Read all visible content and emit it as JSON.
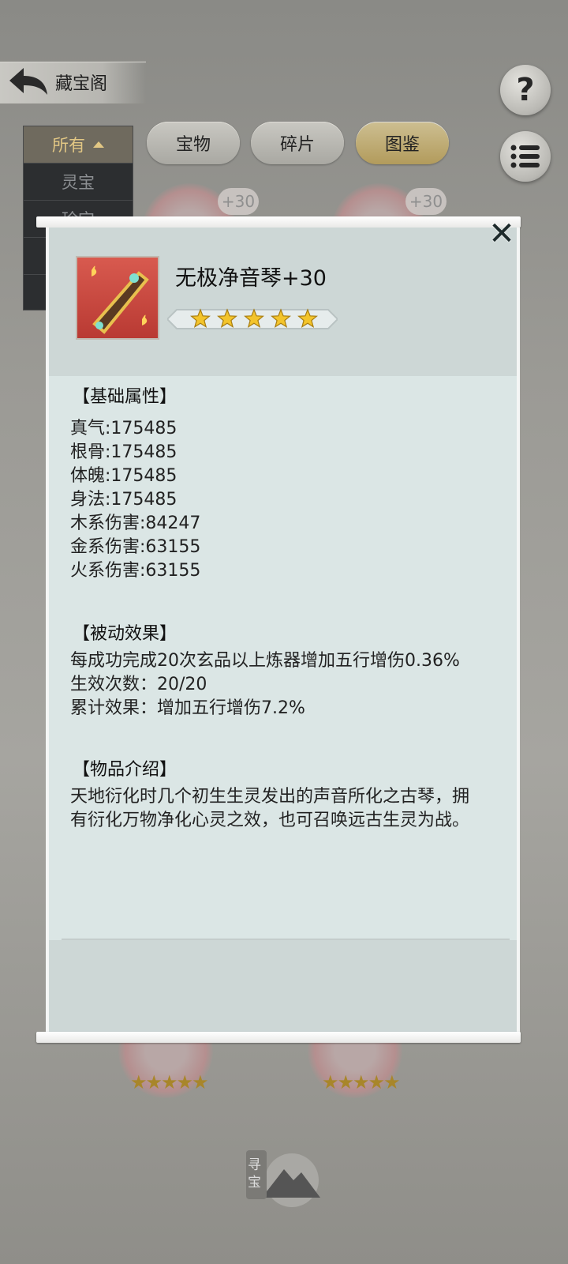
{
  "header": {
    "title": "藏宝阁",
    "help_symbol": "?"
  },
  "filter": {
    "selected": "所有",
    "options": [
      "灵宝",
      "珍宝",
      "",
      ""
    ]
  },
  "tabs": [
    {
      "label": "宝物",
      "active": false
    },
    {
      "label": "碎片",
      "active": false
    },
    {
      "label": "图鉴",
      "active": true
    }
  ],
  "background_items": [
    {
      "badge": "+30"
    },
    {
      "badge": "+30"
    }
  ],
  "bottom_button": {
    "label": "寻宝"
  },
  "detail": {
    "name": "无极净音琴+30",
    "stars": 5,
    "base_attr_title": "【基础属性】",
    "base_attrs": [
      "真气:175485",
      "根骨:175485",
      "体魄:175485",
      "身法:175485",
      "木系伤害:84247",
      "金系伤害:63155",
      "火系伤害:63155"
    ],
    "passive_title": "【被动效果】",
    "passive_lines": [
      "每成功完成20次玄品以上炼器增加五行增伤0.36%",
      "生效次数：20/20",
      "累计效果：增加五行增伤7.2%"
    ],
    "intro_title": "【物品介绍】",
    "intro_text": "天地衍化时几个初生生灵发出的声音所化之古琴，拥有衍化万物净化心灵之效，也可召唤远古生灵为战。",
    "close_symbol": "✕"
  },
  "colors": {
    "modal_bg": "#dbe6e5",
    "active_tab": "#b29b5c",
    "filter_active_text": "#e2c784"
  }
}
